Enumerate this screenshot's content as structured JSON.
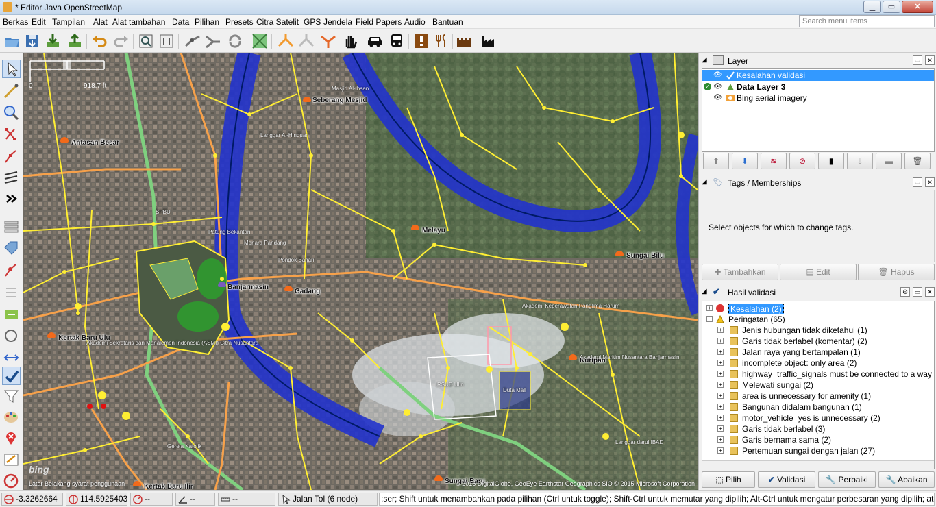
{
  "window": {
    "title": "* Editor Java OpenStreetMap"
  },
  "menu": {
    "items": [
      "Berkas",
      "Edit",
      "Tampilan",
      "Alat",
      "Alat tambahan",
      "Data",
      "Pilihan",
      "Presets",
      "Citra Satelit",
      "GPS",
      "Jendela",
      "Field Papers",
      "Audio",
      "Bantuan"
    ],
    "search_placeholder": "Search menu items"
  },
  "map": {
    "scale": {
      "zero": "0",
      "distance": "918.7 ft"
    },
    "labels": [
      "Seberang Mesjid",
      "Antasan Besar",
      "Melayu",
      "Sungai Bilu",
      "Banjarmasin",
      "Gadang",
      "Kertak Baru Ulu",
      "Kuripan",
      "Sungai Baru",
      "Kertak Baru Ilir"
    ],
    "small_labels": [
      "Masjid Al-Ihsan",
      "Langgar Al-Hinduan",
      "SPBU",
      "Patung Bekantan",
      "Menara Pandang",
      "Pondok Bahari",
      "Akademi Sekretaris dan Manajemen Indonesia (ASMI) Citra Nusantara",
      "Akademi Keperawatan Panglima Harum",
      "Akademi Maritim Nusantara Banjarmasin",
      "RSUD Ulin",
      "Duta Mall",
      "Gereja Katolik",
      "Langgar darul IBAD"
    ],
    "attribution": "© 2015 DigitalGlobe, GeoEye Earthstar Geographics SIO © 2015 Microsoft Corporation",
    "background_terms": "Latar Belakang syarat penggunaan",
    "bing_logo": "bing"
  },
  "layer_panel": {
    "title": "Layer",
    "layers": [
      {
        "name": "Kesalahan validasi",
        "selected": true
      },
      {
        "name": "Data Layer 3",
        "selected": false,
        "bold": true
      },
      {
        "name": "Bing aerial imagery",
        "selected": false
      }
    ]
  },
  "tags_panel": {
    "title": "Tags / Memberships",
    "empty_message": "Select objects for which to change tags.",
    "buttons": {
      "add": "Tambahkan",
      "edit": "Edit",
      "delete": "Hapus"
    }
  },
  "validation_panel": {
    "title": "Hasil validasi",
    "errors": "Kesalahan (2)",
    "warnings": "Peringatan (65)",
    "items": [
      "Jenis hubungan tidak diketahui (1)",
      "Garis tidak berlabel (komentar) (2)",
      "Jalan raya yang bertampalan (1)",
      "incomplete object: only area (2)",
      "highway=traffic_signals must be connected to a way (1)",
      "Melewati sungai (2)",
      "area is unnecessary for amenity (1)",
      "Bangunan didalam bangunan (1)",
      "motor_vehicle=yes is unnecessary (2)",
      "Garis tidak berlabel (3)",
      "Garis bernama sama (2)",
      "Pertemuan sungai dengan jalan (27)"
    ],
    "buttons": {
      "select": "Pilih",
      "validate": "Validasi",
      "fix": "Perbaiki",
      "ignore": "Abaikan"
    }
  },
  "statusbar": {
    "lat": "-3.3262664",
    "lon": "114.5925403",
    "heading": "--",
    "angle": "--",
    "distance": "--",
    "selection": "Jalan Tol (6 node)",
    "help": ":ser; Shift untuk menambahkan pada pilihan (Ctrl untuk toggle); Shift-Ctrl untuk memutar yang dipilih; Alt-Ctrl untuk mengatur perbesaran yang dipilih; atau ubah pilihan"
  },
  "colors": {
    "river": "#2233cc",
    "road_yellow": "#ffee33",
    "road_orange": "#f7a14a",
    "road_green": "#7fd07f",
    "selection_blue": "#3399ff"
  }
}
